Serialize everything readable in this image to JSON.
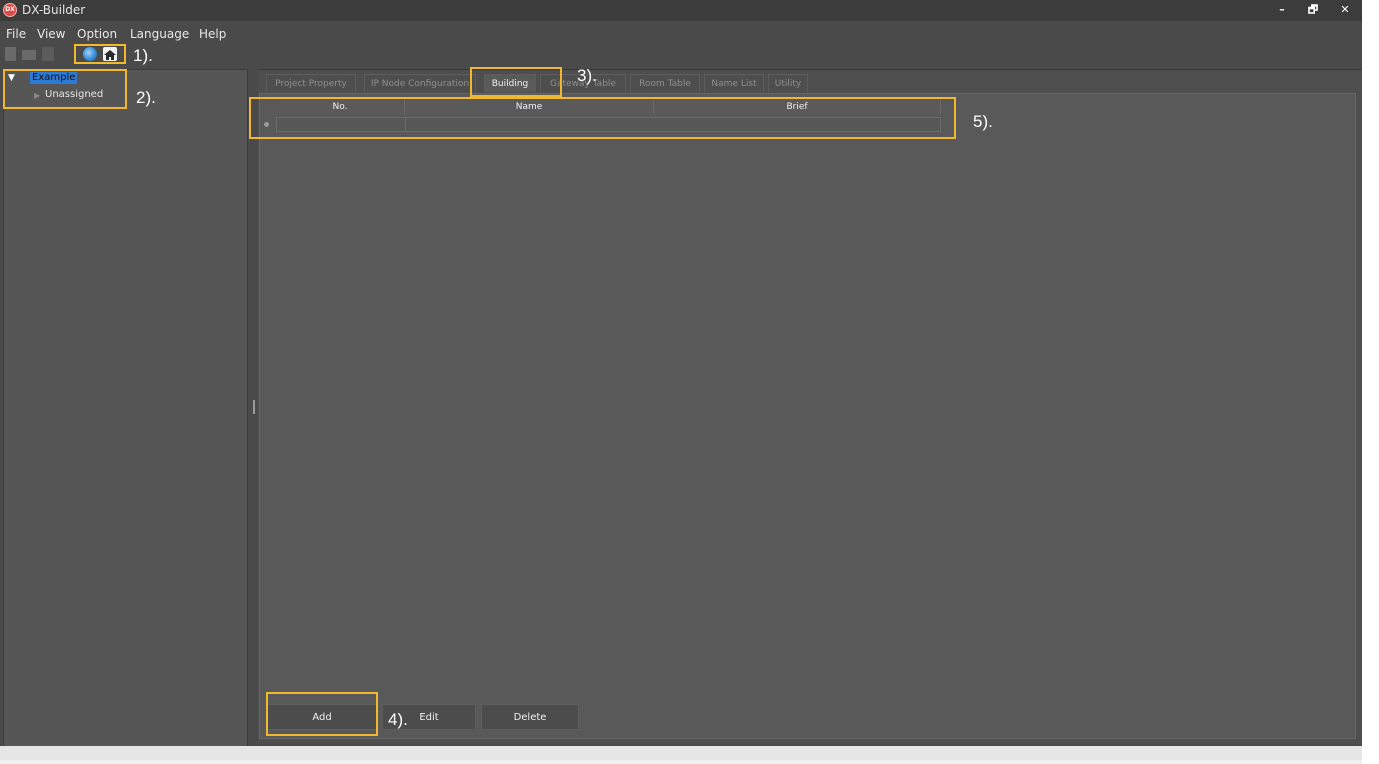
{
  "window": {
    "title": "DX-Builder",
    "app_icon_text": "DX",
    "controls": {
      "minimize": "–",
      "restore": "🗗",
      "close": "✕"
    }
  },
  "menu": {
    "items": [
      "File",
      "View",
      "Option",
      "Language",
      "Help"
    ]
  },
  "toolbar": {
    "icons": [
      "new-icon",
      "open-icon",
      "save-icon",
      "globe-icon",
      "home-icon"
    ]
  },
  "tree": {
    "root_label": "Example",
    "child_label": "Unassigned"
  },
  "tabs": [
    {
      "label": "Project Property"
    },
    {
      "label": "IP Node Configuration"
    },
    {
      "label": "Building",
      "active": true
    },
    {
      "label": "Gateway Table"
    },
    {
      "label": "Room Table"
    },
    {
      "label": "Name List"
    },
    {
      "label": "Utility"
    }
  ],
  "grid": {
    "columns": [
      "No.",
      "Name",
      "Brief"
    ]
  },
  "buttons": {
    "add": "Add",
    "edit": "Edit",
    "delete": "Delete"
  },
  "annotations": {
    "a1": "1).",
    "a2": "2).",
    "a3": "3).",
    "a4": "4).",
    "a5": "5)."
  },
  "colors": {
    "highlight": "#f1b82e",
    "selection": "#2d7ad4",
    "background": "#4a4a4a"
  }
}
